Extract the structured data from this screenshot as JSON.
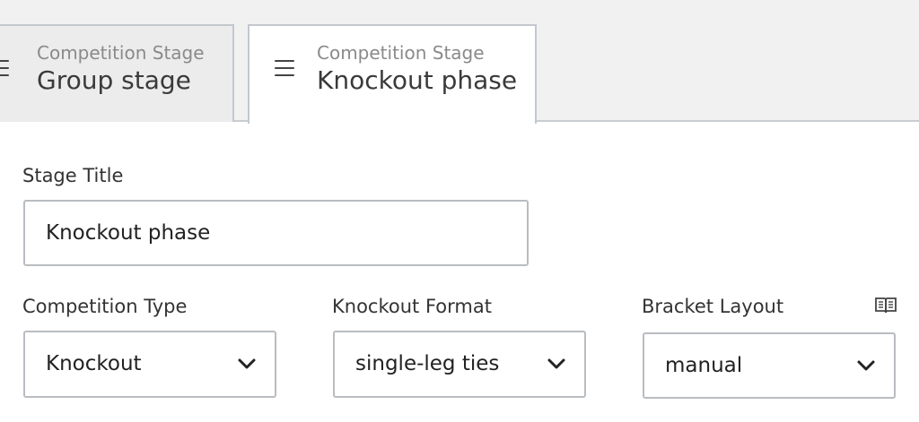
{
  "tabs": [
    {
      "kicker": "Competition Stage",
      "name": "Group stage",
      "active": false
    },
    {
      "kicker": "Competition Stage",
      "name": "Knockout phase",
      "active": true
    }
  ],
  "form": {
    "stage_title": {
      "label": "Stage Title",
      "value": "Knockout phase"
    },
    "competition_type": {
      "label": "Competition Type",
      "value": "Knockout"
    },
    "knockout_format": {
      "label": "Knockout Format",
      "value": "single-leg ties"
    },
    "bracket_layout": {
      "label": "Bracket Layout",
      "value": "manual",
      "help_icon": "book-icon"
    }
  },
  "icons": {
    "tab_handle": "drag-handle-icon",
    "select": "chevron-down-icon"
  }
}
